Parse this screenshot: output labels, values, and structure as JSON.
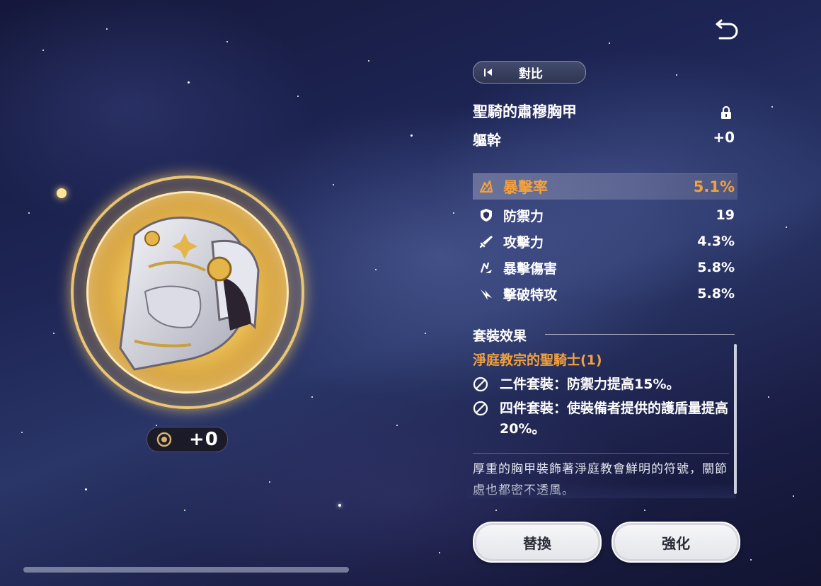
{
  "compare": {
    "label": "對比"
  },
  "item": {
    "name": "聖騎的肅穆胸甲",
    "slot": "軀幹",
    "level": "+0",
    "badge_level": "+0"
  },
  "main_stat": {
    "name": "暴擊率",
    "value": "5.1%",
    "icon": "crit-rate-icon"
  },
  "sub_stats": [
    {
      "name": "防禦力",
      "value": "19",
      "icon": "shield-icon"
    },
    {
      "name": "攻擊力",
      "value": "4.3%",
      "icon": "sword-icon"
    },
    {
      "name": "暴擊傷害",
      "value": "5.8%",
      "icon": "crit-damage-icon"
    },
    {
      "name": "擊破特攻",
      "value": "5.8%",
      "icon": "break-effect-icon"
    }
  ],
  "set": {
    "header": "套裝效果",
    "name": "淨庭教宗的聖騎士(1)",
    "bonuses": [
      {
        "text": "二件套裝：防禦力提高15%。",
        "icon": "inactive-circle-icon"
      },
      {
        "text": "四件套裝：使裝備者提供的護盾量提高20%。",
        "icon": "inactive-circle-icon"
      }
    ]
  },
  "description": "厚重的胸甲裝飾著淨庭教會鮮明的符號，關節處也都密不透風。",
  "buttons": {
    "replace": "替換",
    "enhance": "強化"
  },
  "colors": {
    "accent_orange": "#f2a13d",
    "ring_gold": "#e9bd55"
  }
}
